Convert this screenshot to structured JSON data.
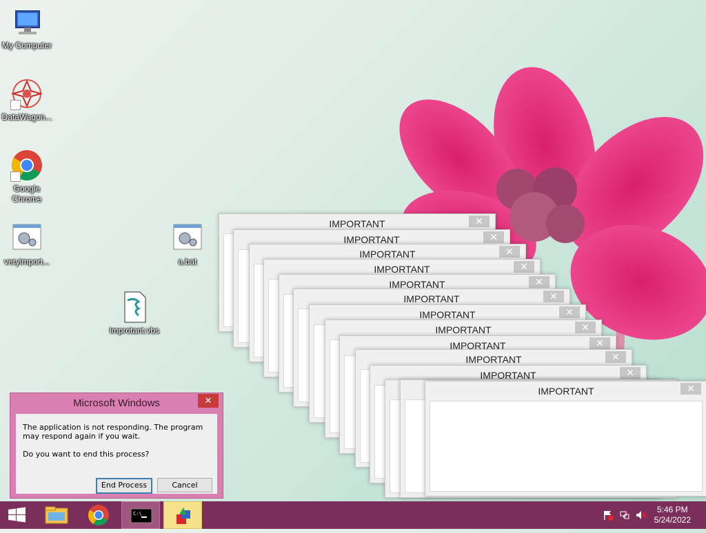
{
  "desktop_icons": [
    {
      "label": "My Computer",
      "icon": "computer-icon"
    },
    {
      "label": "DataWagon...",
      "icon": "datawagon-icon"
    },
    {
      "label": "Google Chrome",
      "icon": "chrome-icon"
    },
    {
      "label": "veryimport...",
      "icon": "batch-file-icon"
    },
    {
      "label": "a.bat",
      "icon": "batch-file-icon"
    },
    {
      "label": "improtant.vbs",
      "icon": "script-file-icon"
    }
  ],
  "popups": {
    "title": "IMPORTANT",
    "close_label": "✕"
  },
  "dialog": {
    "title": "Microsoft Windows",
    "close_label": "✕",
    "message": "The application is not responding. The program may respond again if you wait.",
    "question": "Do you want to end this process?",
    "end_label": "End Process",
    "cancel_label": "Cancel"
  },
  "taskbar": {
    "start_icon": "windows-logo-icon",
    "items": [
      "file-explorer-icon",
      "chrome-icon",
      "command-prompt-icon",
      "script-host-icon"
    ],
    "tray": [
      "action-center-flag-icon",
      "network-icon",
      "volume-muted-icon"
    ],
    "time": "5:46 PM",
    "date": "5/24/2022"
  },
  "colors": {
    "taskbar": "#7b2e5a",
    "dialog_frame": "#d97fb2",
    "close_red": "#c73a3a"
  }
}
